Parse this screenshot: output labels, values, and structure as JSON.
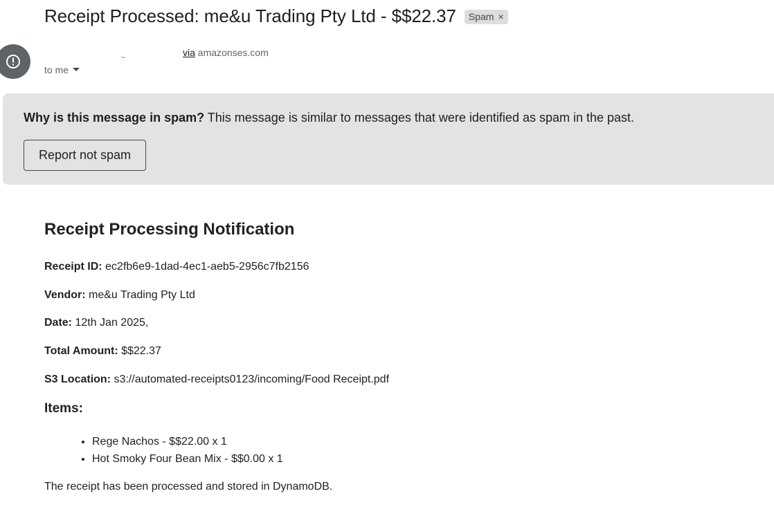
{
  "email": {
    "subject": "Receipt Processed: me&u Trading Pty Ltd - $$22.37",
    "label": "Spam",
    "label_close": "×",
    "via_label": "via",
    "via_domain": " amazonses.com",
    "recipient": "to me"
  },
  "spam_banner": {
    "question": "Why is this message in spam?",
    "explanation": " This message is similar to messages that were identified as spam in the past.",
    "report_button": "Report not spam"
  },
  "receipt": {
    "heading": "Receipt Processing Notification",
    "fields": [
      {
        "label": "Receipt ID:",
        "value": " ec2fb6e9-1dad-4ec1-aeb5-2956c7fb2156"
      },
      {
        "label": "Vendor:",
        "value": " me&u Trading Pty Ltd"
      },
      {
        "label": "Date:",
        "value": " 12th Jan 2025,"
      },
      {
        "label": "Total Amount:",
        "value": " $$22.37"
      },
      {
        "label": "S3 Location:",
        "value": " s3://automated-receipts0123/incoming/Food Receipt.pdf"
      }
    ],
    "items_heading": "Items:",
    "items": [
      "Rege Nachos - $$22.00 x 1",
      "Hot Smoky Four Bean Mix - $$0.00 x 1"
    ],
    "footer": "The receipt has been processed and stored in DynamoDB."
  },
  "icons": {
    "avatar": "spam-warning-icon",
    "recipient_toggle": "caret-down-icon"
  }
}
